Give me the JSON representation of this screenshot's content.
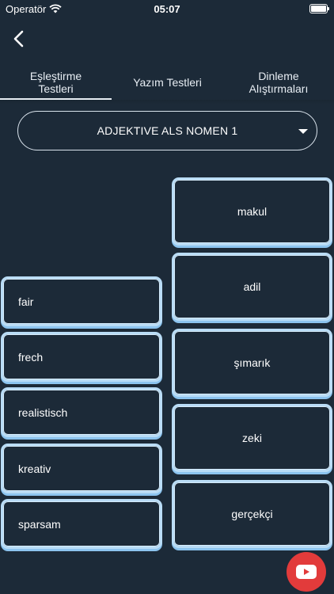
{
  "status_bar": {
    "carrier": "Operatör",
    "time": "05:07"
  },
  "tabs": [
    {
      "label_line1": "Eşleştirme",
      "label_line2": "Testleri",
      "selected": true
    },
    {
      "label_line1": "Yazım Testleri",
      "label_line2": "",
      "selected": false
    },
    {
      "label_line1": "Dinleme",
      "label_line2": "Alıştırmaları",
      "selected": false
    }
  ],
  "dropdown": {
    "selected": "ADJEKTIVE ALS NOMEN 1"
  },
  "left_words": [
    "fair",
    "frech",
    "realistisch",
    "kreativ",
    "sparsam"
  ],
  "right_words": [
    "makul",
    "adil",
    "şımarık",
    "zeki",
    "gerçekçi"
  ],
  "colors": {
    "background": "#1c2a38",
    "card_border": "#b9dcf6",
    "youtube": "#e23b3b"
  },
  "icons": {
    "back": "chevron-left-icon",
    "dropdown": "caret-down-icon",
    "youtube": "youtube-icon"
  }
}
